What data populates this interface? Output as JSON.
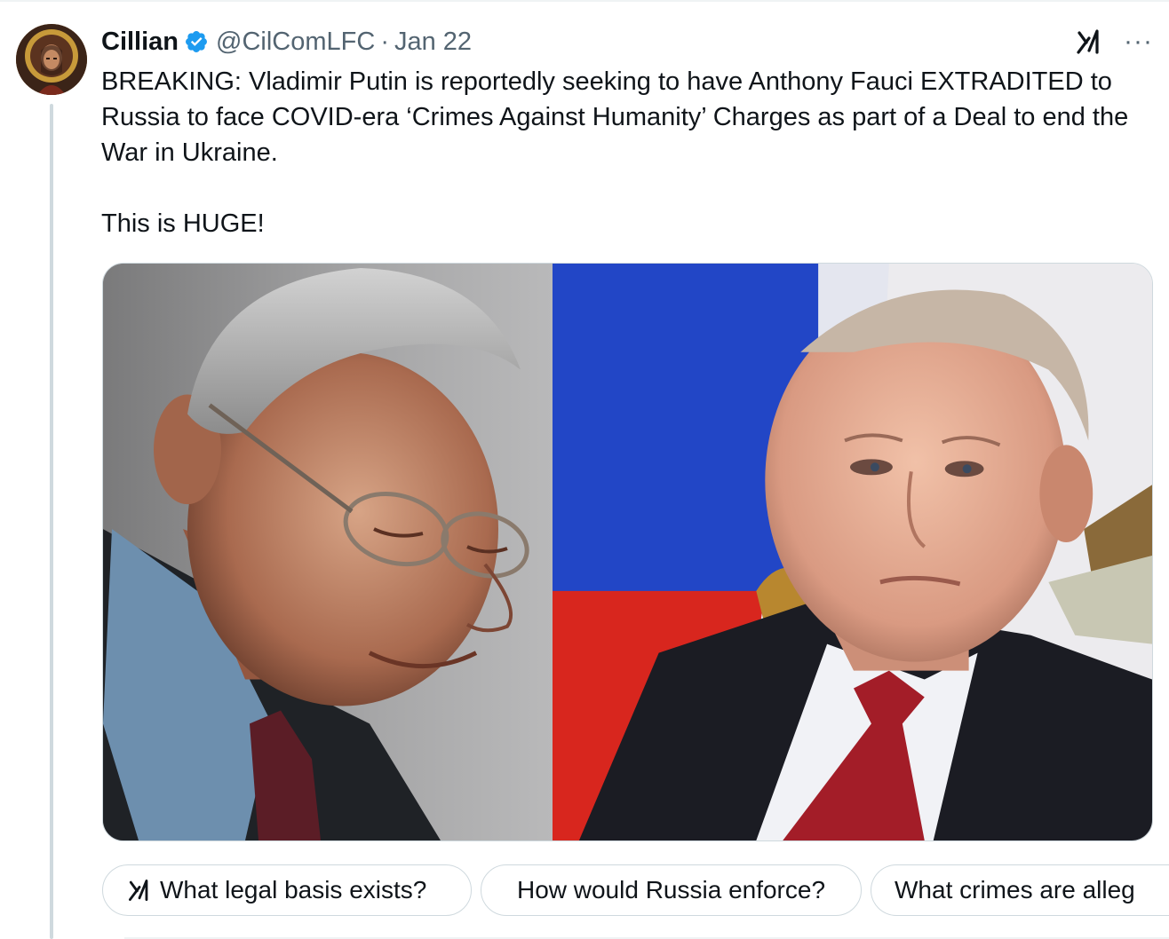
{
  "tweet": {
    "display_name": "Cillian",
    "handle": "@CilComLFC",
    "separator": "·",
    "timestamp": "Jan 22",
    "text": "BREAKING: Vladimir Putin is reportedly seeking to have Anthony Fauci EXTRADITED to Russia to face COVID-era ‘Crimes Against Humanity’ Charges as part of a Deal to end the War in Ukraine.\n\nThis is HUGE!",
    "verified_icon": "verified-badge-icon",
    "more_icon_glyph": "···"
  },
  "grok_suggestions": [
    {
      "label": "What legal basis exists?",
      "icon": "grok-icon"
    },
    {
      "label": "How would Russia enforce?"
    },
    {
      "label": "What crimes are alleg"
    }
  ],
  "colors": {
    "text_primary": "#0f1419",
    "text_secondary": "#536471",
    "verified_blue": "#1d9bf0",
    "border": "#cfd9de"
  }
}
